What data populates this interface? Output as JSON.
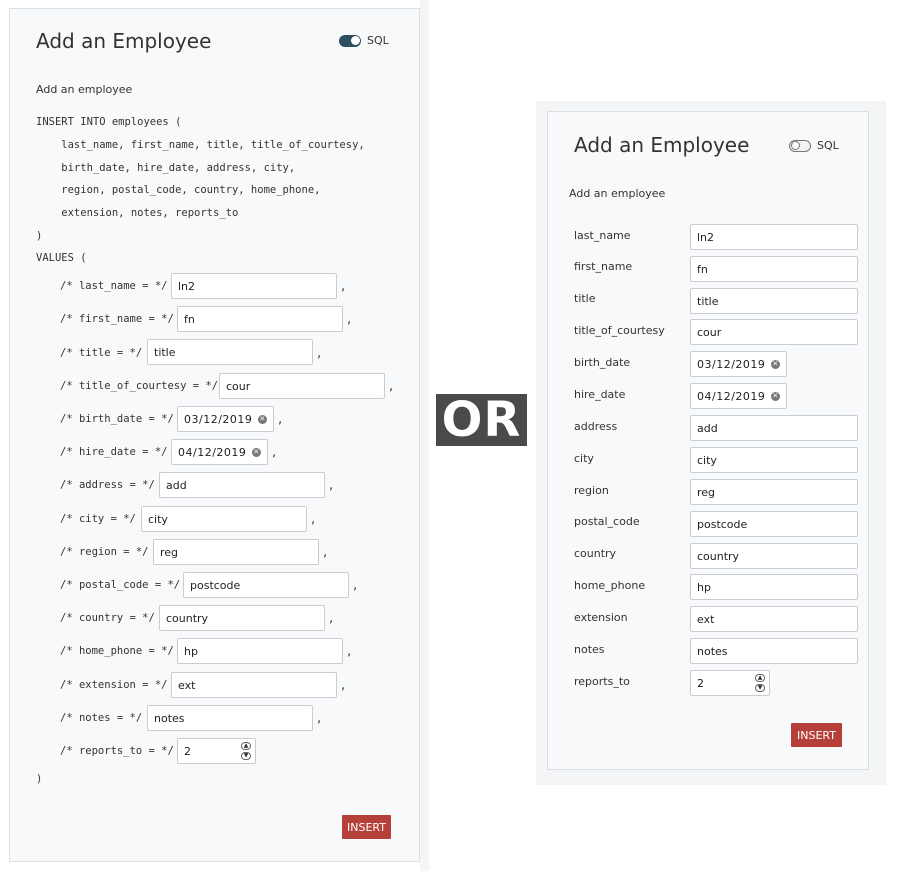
{
  "left": {
    "title": "Add an Employee",
    "sql_toggle": {
      "label": "SQL",
      "on": true
    },
    "subtitle": "Add an employee",
    "sql": {
      "line1": "INSERT INTO employees (",
      "line2": "    last_name, first_name, title, title_of_courtesy,",
      "line3": "    birth_date, hire_date, address, city,",
      "line4": "    region, postal_code, country, home_phone,",
      "line5": "    extension, notes, reports_to",
      "line6": ")",
      "line7": "VALUES (",
      "close": ")",
      "comma": ","
    },
    "fields": [
      {
        "comment": "/* last_name = */",
        "value": "ln2"
      },
      {
        "comment": "/* first_name = */",
        "value": "fn"
      },
      {
        "comment": "/* title = */",
        "value": "title"
      },
      {
        "comment": "/* title_of_courtesy = */",
        "value": "cour"
      },
      {
        "comment": "/* birth_date = */",
        "value": "03/12/2019"
      },
      {
        "comment": "/* hire_date = */",
        "value": "04/12/2019"
      },
      {
        "comment": "/* address = */",
        "value": "add"
      },
      {
        "comment": "/* city = */",
        "value": "city"
      },
      {
        "comment": "/* region = */",
        "value": "reg"
      },
      {
        "comment": "/* postal_code = */",
        "value": "postcode"
      },
      {
        "comment": "/* country = */",
        "value": "country"
      },
      {
        "comment": "/* home_phone = */",
        "value": "hp"
      },
      {
        "comment": "/* extension = */",
        "value": "ext"
      },
      {
        "comment": "/* notes = */",
        "value": "notes"
      },
      {
        "comment": "/* reports_to = */",
        "value": "2"
      }
    ],
    "insert_label": "INSERT"
  },
  "or_label": "OR",
  "right": {
    "title": "Add an Employee",
    "sql_toggle": {
      "label": "SQL",
      "on": false
    },
    "subtitle": "Add an employee",
    "fields": [
      {
        "label": "last_name",
        "value": "ln2"
      },
      {
        "label": "first_name",
        "value": "fn"
      },
      {
        "label": "title",
        "value": "title"
      },
      {
        "label": "title_of_courtesy",
        "value": "cour"
      },
      {
        "label": "birth_date",
        "value": "03/12/2019"
      },
      {
        "label": "hire_date",
        "value": "04/12/2019"
      },
      {
        "label": "address",
        "value": "add"
      },
      {
        "label": "city",
        "value": "city"
      },
      {
        "label": "region",
        "value": "reg"
      },
      {
        "label": "postal_code",
        "value": "postcode"
      },
      {
        "label": "country",
        "value": "country"
      },
      {
        "label": "home_phone",
        "value": "hp"
      },
      {
        "label": "extension",
        "value": "ext"
      },
      {
        "label": "notes",
        "value": "notes"
      },
      {
        "label": "reports_to",
        "value": "2"
      }
    ],
    "insert_label": "INSERT"
  },
  "colors": {
    "insert_button": "#b5403a",
    "toggle_on": "#2f4f5f",
    "panel_bg": "#f8f9fa"
  },
  "icons": {
    "date_clear": "clear-circle-icon",
    "spin": "spinner-arrows-icon"
  }
}
